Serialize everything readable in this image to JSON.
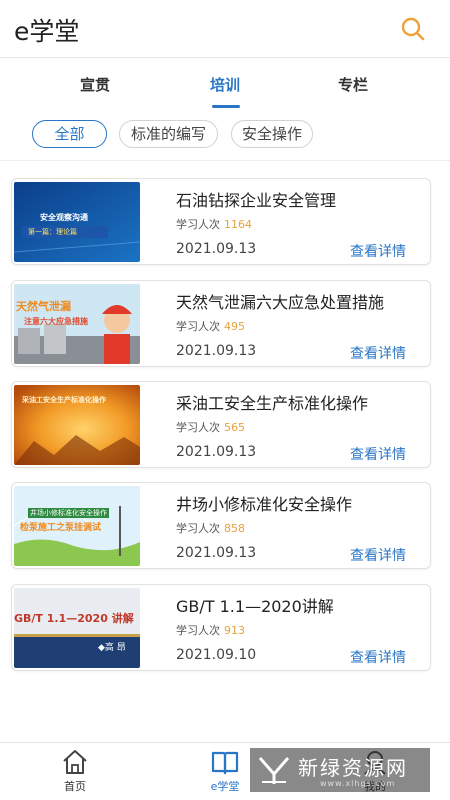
{
  "header": {
    "title": "e学堂",
    "search_icon": "search-icon",
    "accent": "#f0a23a"
  },
  "tabs": [
    {
      "label": "宣贯",
      "active": false
    },
    {
      "label": "培训",
      "active": true
    },
    {
      "label": "专栏",
      "active": false
    }
  ],
  "chips": [
    {
      "label": "全部",
      "active": true
    },
    {
      "label": "标准的编写",
      "active": false
    },
    {
      "label": "安全操作",
      "active": false
    }
  ],
  "courses": [
    {
      "title": "石油钻探企业安全管理",
      "learn_label": "学习人次",
      "learn_count": "1164",
      "date": "2021.09.13",
      "detail": "查看详情",
      "thumb_text": "安全观察沟通",
      "thumb_sub": "第一篇：理论篇"
    },
    {
      "title": "天然气泄漏六大应急处置措施",
      "learn_label": "学习人次",
      "learn_count": "495",
      "date": "2021.09.13",
      "detail": "查看详情",
      "thumb_text": "天然气泄漏",
      "thumb_sub": "注意六大应急措施"
    },
    {
      "title": "采油工安全生产标准化操作",
      "learn_label": "学习人次",
      "learn_count": "565",
      "date": "2021.09.13",
      "detail": "查看详情",
      "thumb_text": "采油工安全生产标准化操作",
      "thumb_sub": ""
    },
    {
      "title": "井场小修标准化安全操作",
      "learn_label": "学习人次",
      "learn_count": "858",
      "date": "2021.09.13",
      "detail": "查看详情",
      "thumb_text": "井场小修标准化安全操作",
      "thumb_sub": "检泵施工之泵挂调试"
    },
    {
      "title": "GB/T 1.1—2020讲解",
      "learn_label": "学习人次",
      "learn_count": "913",
      "date": "2021.09.10",
      "detail": "查看详情",
      "thumb_text": "GB/T 1.1—2020 讲解",
      "thumb_sub": "◆高 昂"
    }
  ],
  "bottom_nav": [
    {
      "label": "首页",
      "icon": "home-icon",
      "active": false
    },
    {
      "label": "e学堂",
      "icon": "book-icon",
      "active": true
    },
    {
      "label": "我的",
      "icon": "user-icon",
      "active": false
    }
  ],
  "watermark": {
    "text": "新绿资源网",
    "sub": "www.xlhgs.com"
  },
  "colors": {
    "primary": "#2a76c6",
    "count": "#e6a23c",
    "search": "#f0a23a"
  }
}
